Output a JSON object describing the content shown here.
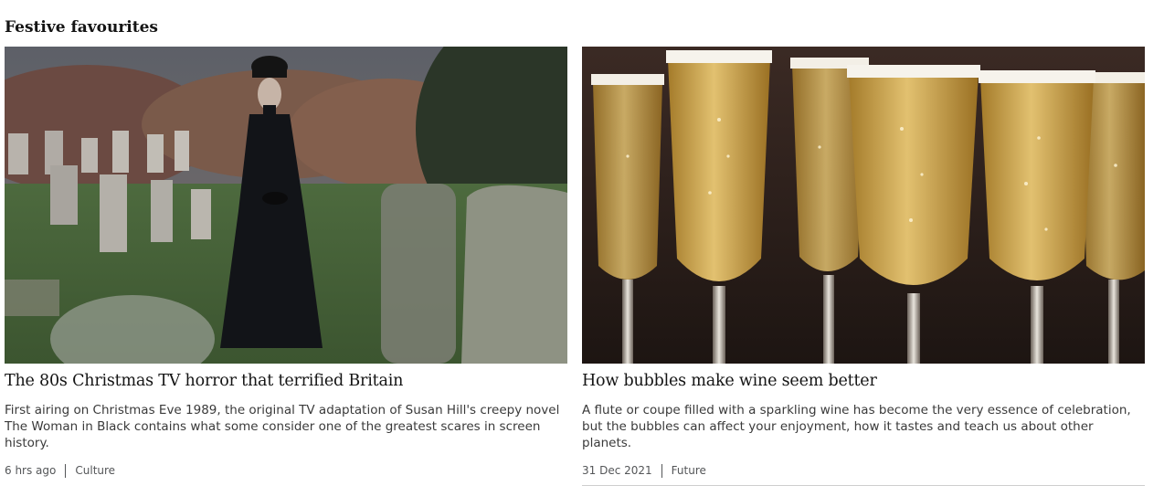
{
  "section": {
    "title": "Festive favourites"
  },
  "cards": [
    {
      "image": "woman-in-graveyard-photo",
      "headline": "The 80s Christmas TV horror that terrified Britain",
      "summary": "First airing on Christmas Eve 1989, the original TV adaptation of Susan Hill's creepy novel The Woman in Black contains what some consider one of the greatest scares in screen history.",
      "date": "6 hrs ago",
      "category": "Culture"
    },
    {
      "image": "champagne-flutes-photo",
      "headline": "How bubbles make wine seem better",
      "summary": "A flute or coupe filled with a sparkling wine has become the very essence of celebration, but the bubbles can affect your enjoyment, how it tastes and teach us about other planets.",
      "date": "31 Dec 2021",
      "category": "Future"
    }
  ]
}
